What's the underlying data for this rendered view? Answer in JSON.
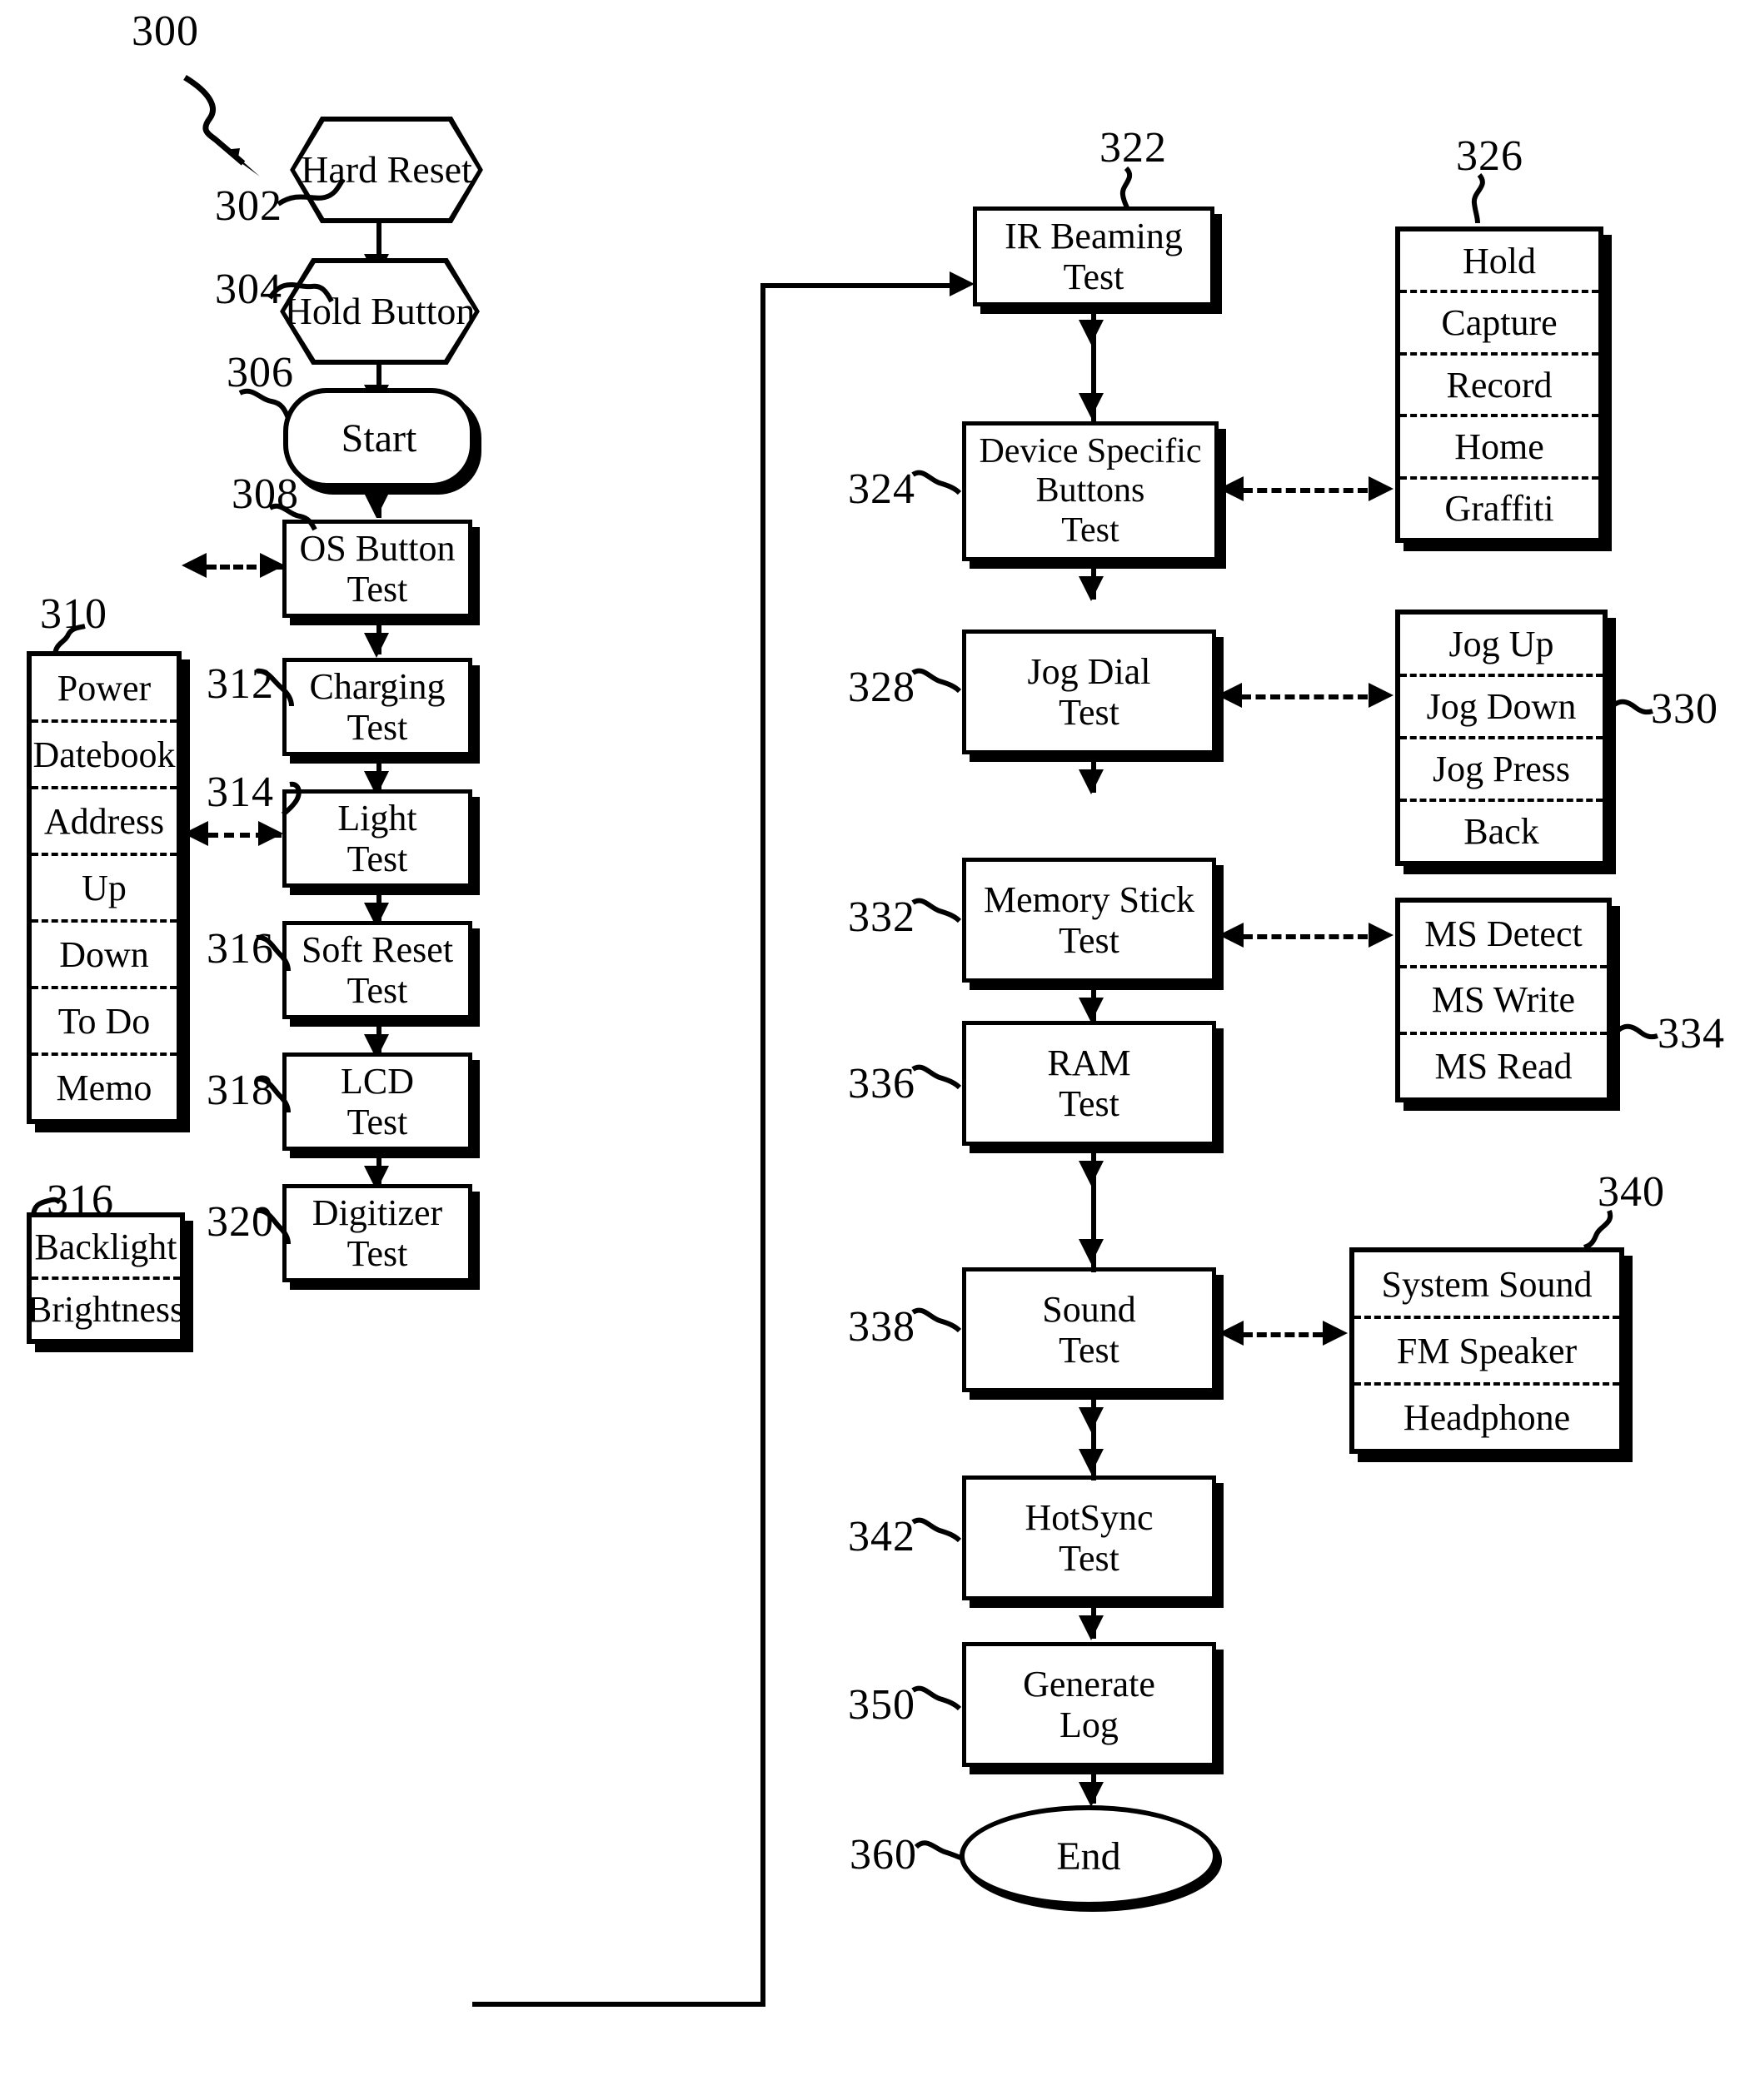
{
  "figure": {
    "main_ref": "300"
  },
  "nodes": {
    "hard_reset": {
      "ref": "302",
      "lines": [
        "Hard",
        "Reset"
      ]
    },
    "hold_button": {
      "ref": "304",
      "lines": [
        "Hold",
        "Button"
      ]
    },
    "start": {
      "ref": "306",
      "lines": [
        "Start"
      ]
    },
    "os_button_test": {
      "ref": "308",
      "lines": [
        "OS Button",
        "Test"
      ]
    },
    "charging_test": {
      "ref": "312",
      "lines": [
        "Charging",
        "Test"
      ]
    },
    "light_test": {
      "ref": "314",
      "lines": [
        "Light",
        "Test"
      ]
    },
    "soft_reset_test": {
      "ref": "316",
      "lines": [
        "Soft Reset",
        "Test"
      ]
    },
    "lcd_test": {
      "ref": "318",
      "lines": [
        "LCD",
        "Test"
      ]
    },
    "digitizer_test": {
      "ref": "320",
      "lines": [
        "Digitizer",
        "Test"
      ]
    },
    "ir_beaming_test": {
      "ref": "322",
      "lines": [
        "IR Beaming",
        "Test"
      ]
    },
    "device_buttons_test": {
      "ref": "324",
      "lines": [
        "Device Specific",
        "Buttons",
        "Test"
      ]
    },
    "jog_dial_test": {
      "ref": "328",
      "lines": [
        "Jog Dial",
        "Test"
      ]
    },
    "memory_stick_test": {
      "ref": "332",
      "lines": [
        "Memory Stick",
        "Test"
      ]
    },
    "ram_test": {
      "ref": "336",
      "lines": [
        "RAM",
        "Test"
      ]
    },
    "sound_test": {
      "ref": "338",
      "lines": [
        "Sound",
        "Test"
      ]
    },
    "hotsync_test": {
      "ref": "342",
      "lines": [
        "HotSync",
        "Test"
      ]
    },
    "generate_log": {
      "ref": "350",
      "lines": [
        "Generate",
        "Log"
      ]
    },
    "end": {
      "ref": "360",
      "lines": [
        "End"
      ]
    }
  },
  "listboxes": {
    "os_buttons": {
      "ref": "310",
      "items": [
        "Power",
        "Datebook",
        "Address",
        "Up",
        "Down",
        "To Do",
        "Memo"
      ]
    },
    "light_items": {
      "ref": "316",
      "items": [
        "Backlight",
        "Brightness"
      ]
    },
    "device_buttons": {
      "ref": "326",
      "items": [
        "Hold",
        "Capture",
        "Record",
        "Home",
        "Graffiti"
      ]
    },
    "jog_items": {
      "ref": "330",
      "items": [
        "Jog Up",
        "Jog Down",
        "Jog Press",
        "Back"
      ]
    },
    "ms_items": {
      "ref": "334",
      "items": [
        "MS Detect",
        "MS Write",
        "MS Read"
      ]
    },
    "sound_items": {
      "ref": "340",
      "items": [
        "System Sound",
        "FM Speaker",
        "Headphone"
      ]
    }
  }
}
